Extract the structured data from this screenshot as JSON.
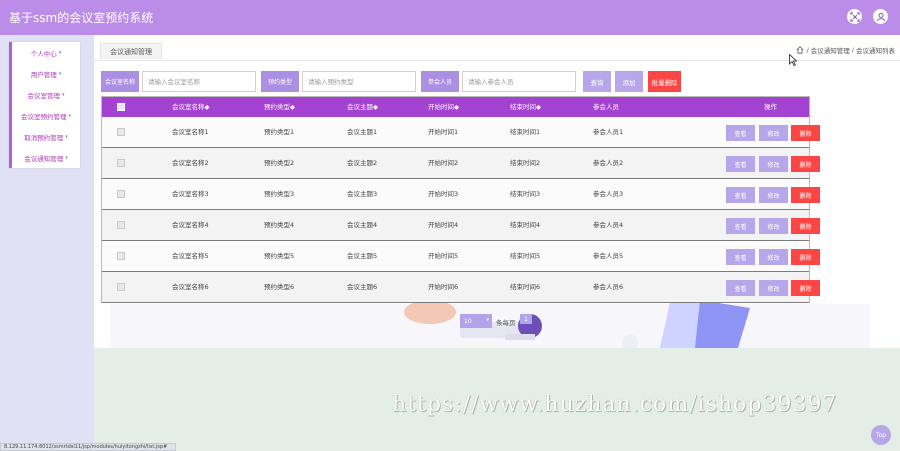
{
  "header": {
    "app_title": "基于ssm的会议室预约系统",
    "icons": [
      "fullscreen-icon",
      "user-icon"
    ]
  },
  "sidebar": {
    "items": [
      {
        "label": "个人中心"
      },
      {
        "label": "用户管理"
      },
      {
        "label": "会议室管理"
      },
      {
        "label": "会议室预约管理"
      },
      {
        "label": "取消预约管理"
      },
      {
        "label": "会议通知管理"
      }
    ]
  },
  "tab": {
    "label": "会议通知管理"
  },
  "breadcrumb": {
    "items": [
      "会议通知管理",
      "会议通知列表"
    ],
    "separator": "/"
  },
  "search": {
    "name_label": "会议室名称",
    "name_placeholder": "请输入会议室名称",
    "type_label": "预约类型",
    "type_placeholder": "请输入预约类型",
    "people_label": "参会人员",
    "people_placeholder": "请输入参会人员",
    "search_button": "查询",
    "add_button": "添加",
    "batch_delete_button": "批量删除"
  },
  "table": {
    "columns": [
      "会议室名称◆",
      "预约类型◆",
      "会议主题◆",
      "开始时间◆",
      "结束时间◆",
      "参会人员",
      "操作"
    ],
    "rows": [
      [
        "会议室名称1",
        "预约类型1",
        "会议主题1",
        "开始时间1",
        "结束时间1",
        "参会人员1"
      ],
      [
        "会议室名称2",
        "预约类型2",
        "会议主题2",
        "开始时间2",
        "结束时间2",
        "参会人员2"
      ],
      [
        "会议室名称3",
        "预约类型3",
        "会议主题3",
        "开始时间3",
        "结束时间3",
        "参会人员3"
      ],
      [
        "会议室名称4",
        "预约类型4",
        "会议主题4",
        "开始时间4",
        "结束时间4",
        "参会人员4"
      ],
      [
        "会议室名称5",
        "预约类型5",
        "会议主题5",
        "开始时间5",
        "结束时间5",
        "参会人员5"
      ],
      [
        "会议室名称6",
        "预约类型6",
        "会议主题6",
        "开始时间6",
        "结束时间6",
        "参会人员6"
      ]
    ],
    "actions": {
      "view": "查看",
      "edit": "修改",
      "delete": "删除"
    }
  },
  "pagination": {
    "page_size": "10",
    "per_page_label": "条每页",
    "current_page": "1"
  },
  "watermark": "https://www.huzhan.com/ishop39397",
  "status_url": "8.129.11.174:8012/ssmrtdsl11/jsp/modules/huiyitongzhi/list.jsp#",
  "top_button": "Top",
  "colors": {
    "topbar": "#bb8de9",
    "table_header": "#a442d1",
    "button_purple": "#b7a6ea",
    "button_red": "#fc4545",
    "sidebar_text": "#b03ab8"
  }
}
